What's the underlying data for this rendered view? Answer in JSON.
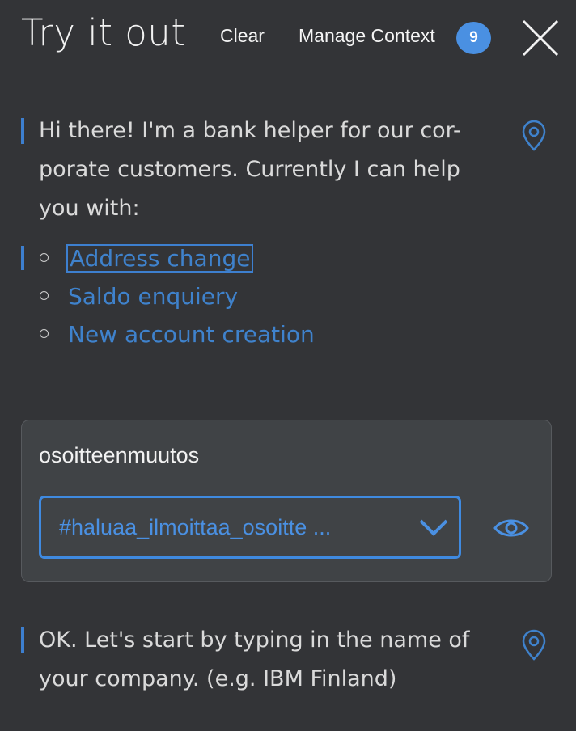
{
  "header": {
    "title": "Try it out",
    "clear_label": "Clear",
    "manage_context_label": "Manage Context",
    "context_count": "9"
  },
  "conversation": {
    "bot_message_1": [
      "Hi there! I'm a bank helper for our cor-",
      "porate customers. Currently I can help",
      "you with:"
    ],
    "options": [
      {
        "label": "Address change"
      },
      {
        "label": "Saldo enquiery"
      },
      {
        "label": "New account creation"
      }
    ],
    "intent_card": {
      "title": "osoitteenmuutos",
      "selected_intent": "#haluaa_ilmoittaa_osoitte ..."
    },
    "bot_message_2": [
      "OK. Let's start by typing in the name of",
      "your company. (e.g. IBM Finland)"
    ]
  },
  "colors": {
    "background": "#333437",
    "accent": "#4a90e2",
    "card": "#404346"
  },
  "icons": {
    "close": "close-icon",
    "location": "location-pin-icon",
    "dropdown": "chevron-down-icon",
    "visibility": "eye-icon"
  }
}
